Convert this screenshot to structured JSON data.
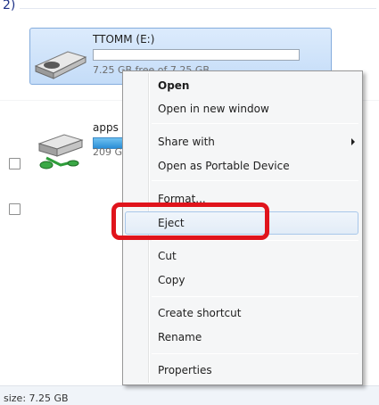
{
  "explorer": {
    "group_header": "2)",
    "drive_e": {
      "name": "TTOMM (E:)",
      "size": "7.25 GB free of 7.25 GB"
    },
    "apps": {
      "name": "apps",
      "size": "209 GB"
    },
    "status_text": "size: 7.25 GB"
  },
  "menu": {
    "open": "Open",
    "open_new_window": "Open in new window",
    "share_with": "Share with",
    "open_portable": "Open as Portable Device",
    "format": "Format...",
    "eject": "Eject",
    "cut": "Cut",
    "copy": "Copy",
    "create_shortcut": "Create shortcut",
    "rename": "Rename",
    "properties": "Properties"
  },
  "colors": {
    "highlight": "#e0141c",
    "selection": "#c4dcf8",
    "menu_bg": "#f5f6f7"
  }
}
